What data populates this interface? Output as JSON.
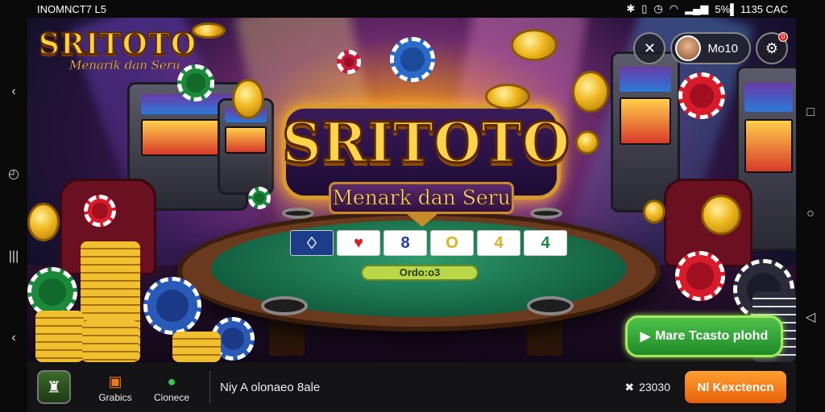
{
  "status_bar": {
    "left_text": "INOMNCT7 L5",
    "right_text": "5%▌ 1135 CAC"
  },
  "logo": {
    "title": "SRITOTO",
    "tagline": "Menark dan Seru"
  },
  "logo_small": {
    "title": "SRITOTO",
    "tagline": "Menarik dan Seru"
  },
  "user": {
    "name": "Mo10",
    "notification_count": "0"
  },
  "table": {
    "cards": [
      "♢",
      "♥",
      "8",
      "O",
      "4",
      "4"
    ],
    "label": "Ordo:o3"
  },
  "promo_button": {
    "label": "Mare Tcasto plohd",
    "icon": "play-icon"
  },
  "bottom_bar": {
    "tab1_label": "Grabics",
    "tab2_label": "Cionece",
    "message": "Niy A olonaeo 8ale",
    "balance": "23030",
    "cta_label": "Nl Kexctencn"
  },
  "colors": {
    "accent_gold": "#ffd34a",
    "cta_orange": "#f07a18",
    "promo_green": "#2e9e30"
  }
}
